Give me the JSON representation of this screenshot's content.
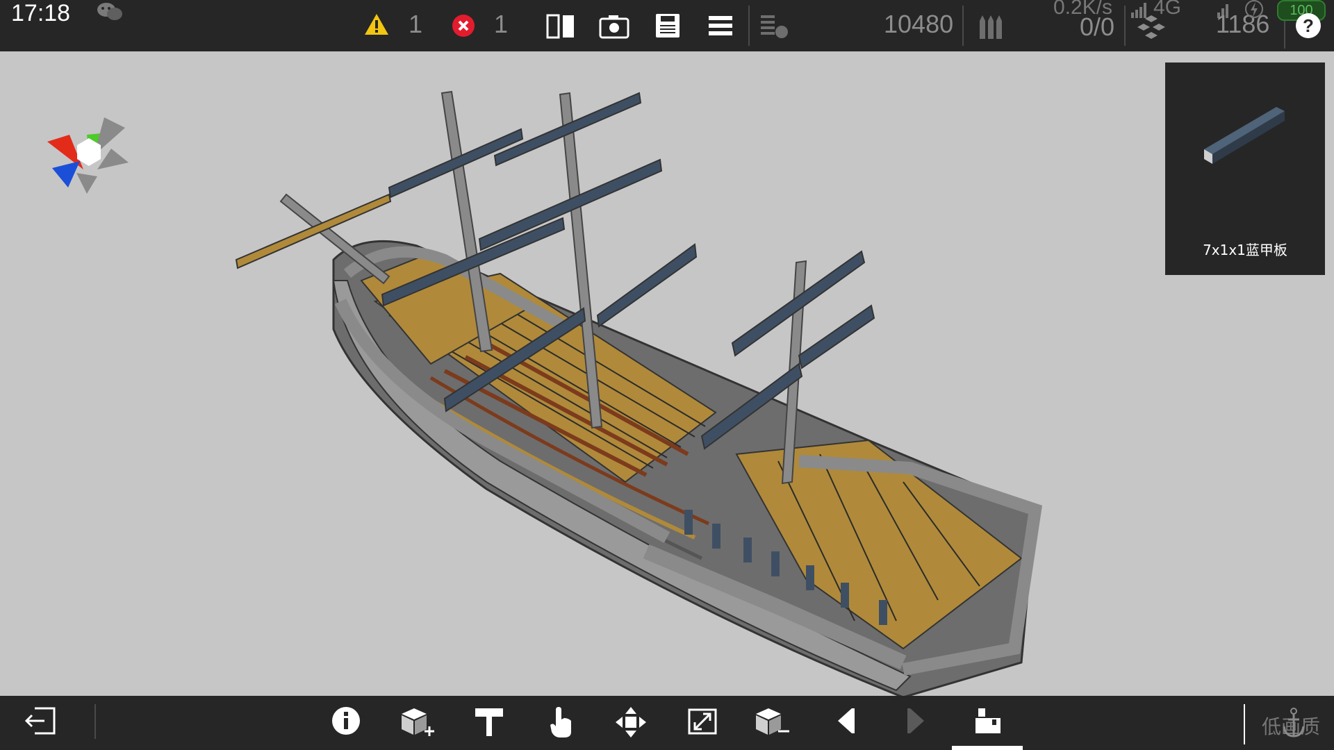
{
  "status": {
    "time": "17:18",
    "net_speed": "0.2K/s",
    "network": "4G",
    "battery": "100"
  },
  "toolbar": {
    "warning_count": "1",
    "error_count": "1",
    "block_count": "10480",
    "ratio": "0/0",
    "weight": "1186"
  },
  "selected_part": {
    "name": "7x1x1蓝甲板"
  },
  "bottom": {
    "quality_label": "低画质"
  },
  "colors": {
    "deck_wood": "#b08a3a",
    "deck_blue": "#3f4f63",
    "frame_gray": "#8a8a8a",
    "viewport_bg": "#c6c6c6",
    "bar_bg": "#262626"
  },
  "icons": [
    "wechat-icon",
    "warning-icon",
    "error-icon",
    "mirror-icon",
    "camera-icon",
    "save-icon",
    "menu-icon",
    "layers-icon",
    "ammo-icon",
    "cluster-icon",
    "help-icon",
    "exit-icon",
    "info-icon",
    "add-block-icon",
    "paint-icon",
    "hand-icon",
    "move-icon",
    "scale-icon",
    "remove-block-icon",
    "undo-icon",
    "redo-icon",
    "build-icon",
    "anchor-icon",
    "axis-gizmo-icon"
  ]
}
